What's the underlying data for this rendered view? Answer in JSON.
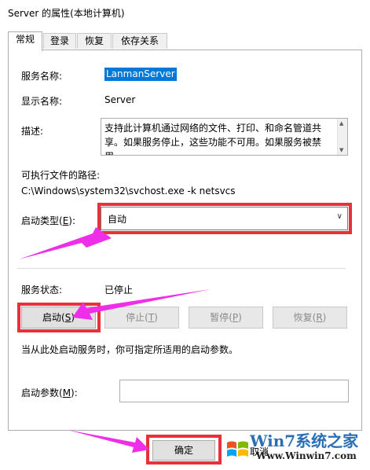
{
  "window": {
    "title": "Server 的属性(本地计算机)"
  },
  "tabs": [
    {
      "label": "常规",
      "active": true
    },
    {
      "label": "登录",
      "active": false
    },
    {
      "label": "恢复",
      "active": false
    },
    {
      "label": "依存关系",
      "active": false
    }
  ],
  "general": {
    "service_name_label": "服务名称:",
    "service_name_value": "LanmanServer",
    "display_name_label": "显示名称:",
    "display_name_value": "Server",
    "description_label": "描述:",
    "description_text": "支持此计算机通过网络的文件、打印、和命名管道共享。如果服务停止，这些功能不可用。如果服务被禁用，",
    "exec_path_label": "可执行文件的路径:",
    "exec_path_value": "C:\\Windows\\system32\\svchost.exe -k netsvcs",
    "startup_type_label_prefix": "启动类型(",
    "startup_type_label_key": "E",
    "startup_type_label_suffix": "):",
    "startup_type_value": "自动",
    "service_status_label": "服务状态:",
    "service_status_value": "已停止",
    "hint_text": "当从此处启动服务时，你可指定所适用的启动参数。",
    "start_params_label_prefix": "启动参数(",
    "start_params_label_key": "M",
    "start_params_label_suffix": "):",
    "start_params_value": ""
  },
  "buttons": {
    "start": {
      "prefix": "启动(",
      "key": "S",
      "suffix": ")"
    },
    "stop": {
      "prefix": "停止(",
      "key": "T",
      "suffix": ")"
    },
    "pause": {
      "prefix": "暂停(",
      "key": "P",
      "suffix": ")"
    },
    "resume": {
      "prefix": "恢复(",
      "key": "R",
      "suffix": ")"
    },
    "ok": "确定",
    "cancel": "取消"
  },
  "watermark": {
    "brand": "Win7系统之家",
    "url": "Www.Winwin7.com"
  },
  "colors": {
    "annotation_red": "#e8313b",
    "annotation_magenta": "#ee2ee8",
    "selection_blue": "#0078d7"
  }
}
